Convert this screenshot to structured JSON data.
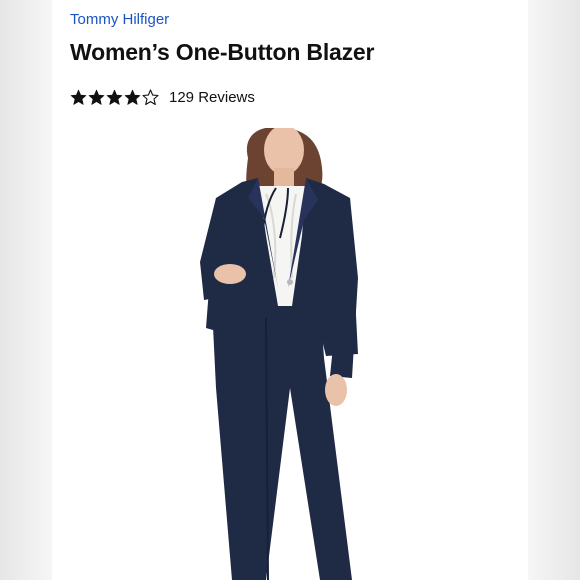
{
  "product": {
    "brand": "Tommy Hilfiger",
    "title": "Women’s One-Button Blazer",
    "rating": 4,
    "rating_max": 5,
    "reviews_label": "129 Reviews"
  },
  "icons": {
    "star_filled": "star-filled-icon",
    "star_empty": "star-empty-icon"
  },
  "colors": {
    "brand_link": "#1a55c4",
    "text": "#111111",
    "blazer_navy": "#1f2a44",
    "blouse": "#f5f5f3"
  }
}
